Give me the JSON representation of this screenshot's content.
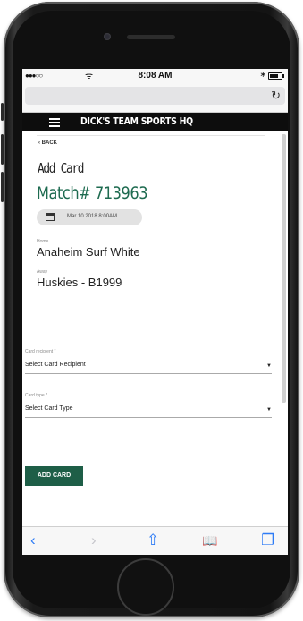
{
  "status": {
    "signal": "●●●○○",
    "wifi": "ᯤ",
    "time": "8:08 AM",
    "bluetooth": "∗"
  },
  "browser": {
    "reload_icon": "↻"
  },
  "nav": {
    "brand": "DICK'S TEAM SPORTS HQ"
  },
  "page": {
    "back_label": "‹ BACK",
    "title": "Add Card",
    "match": "Match# 713963",
    "date": "Mar 10 2018 8:00AM",
    "home_label": "Home",
    "home_team": "Anaheim Surf White",
    "away_label": "Away",
    "away_team": "Huskies - B1999"
  },
  "form": {
    "recipient_label": "Card recipient *",
    "recipient_value": "Select Card Recipient",
    "type_label": "Card type *",
    "type_value": "Select Card Type",
    "caret": "▼",
    "submit": "ADD CARD"
  },
  "toolbar": {
    "back": "‹",
    "forward": "›",
    "share": "⇧",
    "bookmarks": "📖",
    "tabs": "❐"
  },
  "colors": {
    "accent": "#1e6b50",
    "button": "#1e5e47",
    "ios_blue": "#2e7cf6"
  }
}
